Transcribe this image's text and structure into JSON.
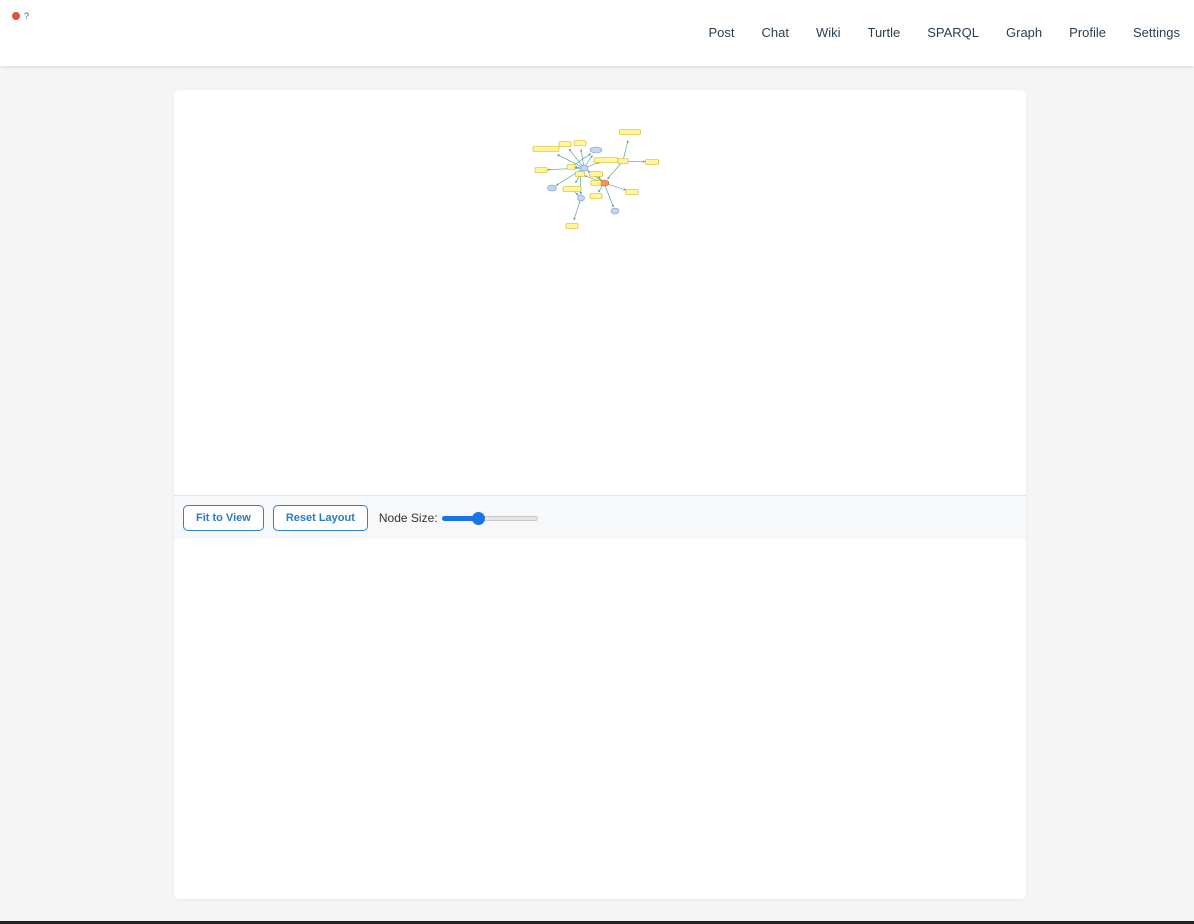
{
  "status": {
    "indicator_color": "#e74c3c",
    "text": "?"
  },
  "nav": {
    "items": [
      {
        "label": "Post"
      },
      {
        "label": "Chat"
      },
      {
        "label": "Wiki"
      },
      {
        "label": "Turtle"
      },
      {
        "label": "SPARQL"
      },
      {
        "label": "Graph"
      },
      {
        "label": "Profile"
      },
      {
        "label": "Settings"
      }
    ]
  },
  "graph": {
    "colors": {
      "literal_fill": "#fff59d",
      "literal_stroke": "#d4b106",
      "resource_fill": "#c5d3f5",
      "resource_stroke": "#7b93d6",
      "focus_fill": "#f0955b",
      "focus_stroke": "#c8602c",
      "edge": "#3f9a8c"
    }
  },
  "controls": {
    "fit_label": "Fit to View",
    "reset_label": "Reset Layout",
    "node_size_label": "Node Size:",
    "node_size_value": 0.38
  },
  "colors": {
    "accent": "#1a73e8",
    "button_border": "#3182ce"
  }
}
